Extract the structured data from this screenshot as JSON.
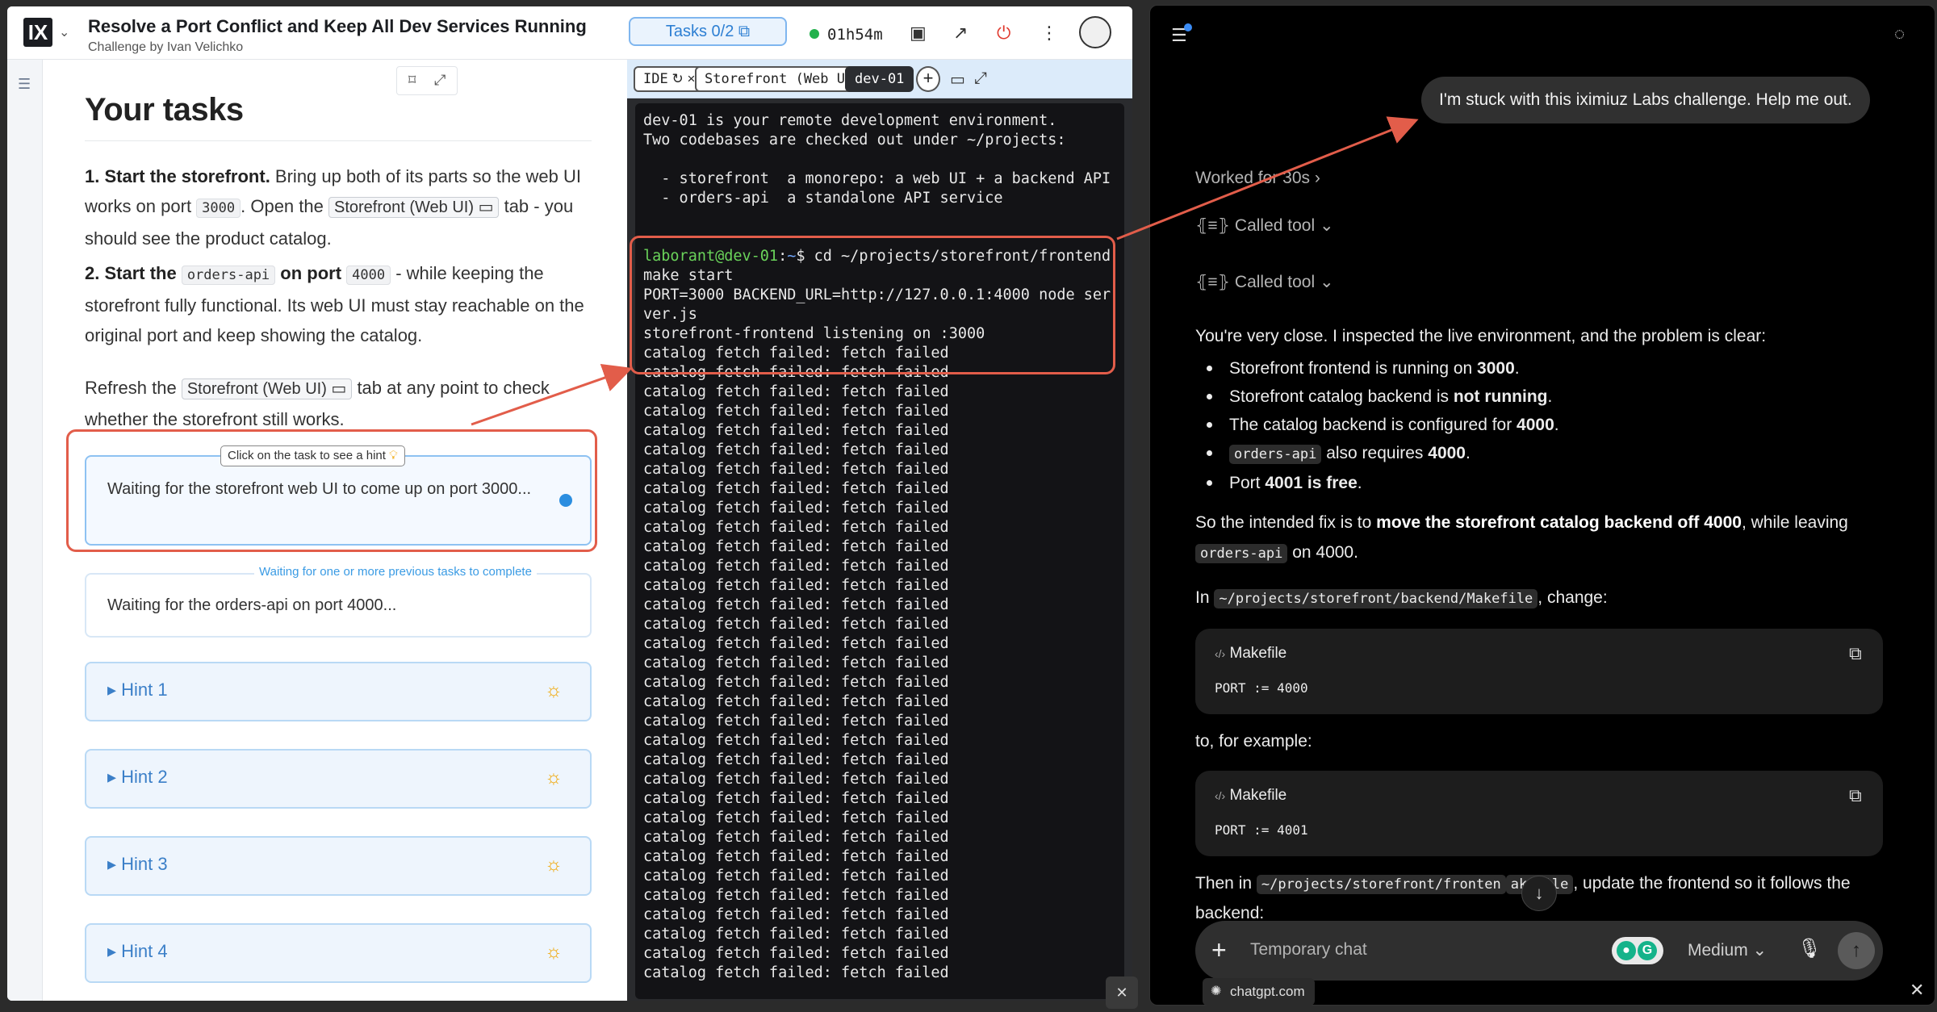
{
  "topbar": {
    "logo": "IX",
    "title": "Resolve a Port Conflict and Keep All Dev Services Running",
    "author": "Challenge by Ivan Velichko",
    "tasks_pill": "Tasks 0/2",
    "timer": "01h54m"
  },
  "tasks": {
    "heading": "Your tasks",
    "p1": {
      "bold": "1. Start the storefront.",
      "t1": " Bring up both of its parts so the web UI works on port ",
      "port": "3000",
      "t2": ". Open the ",
      "tab": "Storefront (Web UI)",
      "t3": " tab - you should see the product catalog."
    },
    "p2": {
      "b1": "2. Start the ",
      "svc": "orders-api",
      "b2": " on port ",
      "port": "4000",
      "t1": " - while keeping the storefront fully functional. Its web UI must stay reachable on the original port and keep showing the catalog."
    },
    "p3": {
      "t1": "Refresh the ",
      "tab": "Storefront (Web UI)",
      "t2": " tab at any point to check whether the storefront still works."
    },
    "tooltip": "Click on the task to see a hint",
    "task1": "Waiting for the storefront web UI to come up on port 3000...",
    "task2_label": "Waiting for one or more previous tasks to complete",
    "task2": "Waiting for the orders-api on port 4000...",
    "hints": [
      "Hint 1",
      "Hint 2",
      "Hint 3",
      "Hint 4"
    ]
  },
  "ide_tabs": {
    "ide": "IDE",
    "storefront": "Storefront (Web UI)",
    "dev": "dev-01",
    "plus": "+"
  },
  "terminal": {
    "intro": [
      "dev-01 is your remote development environment.",
      "Two codebases are checked out under ~/projects:",
      "",
      "  - storefront  a monorepo: a web UI + a backend API",
      "  - orders-api  a standalone API service",
      "",
      ""
    ],
    "prompt_user": "laborant@dev-01",
    "prompt_sep": ":",
    "prompt_path": "~",
    "prompt_cmd": "$ cd ~/projects/storefront/frontend",
    "output": [
      "make start",
      "PORT=3000 BACKEND_URL=http://127.0.0.1:4000 node ser",
      "ver.js",
      "storefront-frontend listening on :3000"
    ],
    "failed_line": "catalog fetch failed: fetch failed",
    "failed_count": 33
  },
  "chat": {
    "user_msg": "I'm stuck with this iximiuz Labs challenge. Help me out.",
    "worked": "Worked for 30s",
    "called_tool": "Called tool",
    "intro": "You're very close. I inspected the live environment, and the problem is clear:",
    "bullets": [
      {
        "pre": "Storefront frontend is running on ",
        "b": "3000",
        "post": "."
      },
      {
        "pre": "Storefront catalog backend is ",
        "b": "not running",
        "post": "."
      },
      {
        "pre": "The catalog backend is configured for ",
        "b": "4000",
        "post": "."
      },
      {
        "code": "orders-api",
        "pre": " also requires ",
        "b": "4000",
        "post": "."
      },
      {
        "pre": "Port ",
        "b": "4001 is free",
        "post": "."
      }
    ],
    "fix": {
      "t1": "So the intended fix is to ",
      "b": "move the storefront catalog backend off 4000",
      "t2": ", while leaving ",
      "code": "orders-api",
      "t3": " on 4000."
    },
    "in_file": {
      "t1": "In ",
      "code": "~/projects/storefront/backend/Makefile",
      "t2": ", change:"
    },
    "code1": {
      "lang": "Makefile",
      "code": "PORT := 4000"
    },
    "to_example": "to, for example:",
    "code2": {
      "lang": "Makefile",
      "code": "PORT := 4001"
    },
    "then": {
      "t1": "Then in ",
      "code": "~/projects/storefront/fronten",
      "code2": "akefile",
      "t2": ", update the frontend so it follows the backend:"
    },
    "placeholder": "Temporary chat",
    "model": "Medium",
    "site": "chatgpt.com"
  },
  "colors": {
    "accent_blue": "#2d7fd3",
    "annotation_red": "#e25d4a",
    "terminal_bg": "#131316",
    "prompt_green": "#6ad35a"
  }
}
